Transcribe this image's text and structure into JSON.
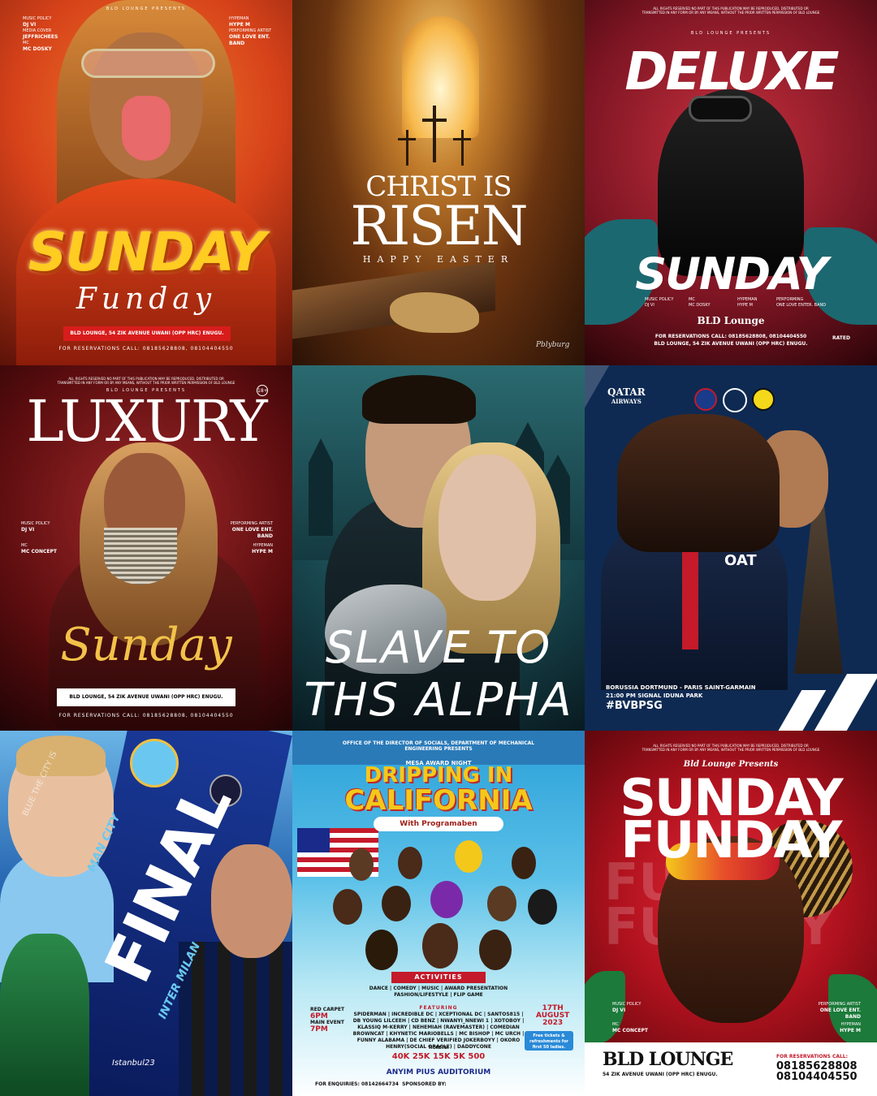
{
  "tiles": {
    "t1": {
      "presenter": "BLD LOUNGE PRESENTS",
      "left_roles": [
        "MUSIC POLICY",
        "DJ VI",
        "MEDIA COVER",
        "JEFFRICHEES",
        "MC",
        "MC DOSKY"
      ],
      "right_roles": [
        "HYPEMAN",
        "HYPE M",
        "PERFORMING ARTIST",
        "ONE LOVE ENT.",
        "BAND"
      ],
      "title": "SUNDAY",
      "script": "Funday",
      "address": "BLD LOUNGE, 54 ZIK AVENUE UWANI (OPP HRC) ENUGU.",
      "reservations": "FOR RESERVATIONS CALL: 08185628808, 08104404550"
    },
    "t2": {
      "line1": "CHRIST IS",
      "line2": "RISEN",
      "line3": "HAPPY EASTER",
      "signature": "Pblyburg"
    },
    "t3": {
      "notice": "ALL RIGHTS RESERVED NO PART OF THIS PUBLICATION MAY BE REPRODUCED, DISTRIBUTED OR TRANSMITTED IN ANY FORM OR BY ANY MEANS, WITHOUT THE PRIOR WRITTEN PERMISSION OF BLD LOUNGE",
      "presenter": "BLD LOUNGE PRESENTS",
      "title": "DELUXE",
      "title2": "SUNDAY",
      "roles": [
        "MUSIC POLICY",
        "DJ VI",
        "MC",
        "MC DOSKY",
        "HYPEMAN",
        "HYPE M",
        "PERFORMING",
        "ONE LOVE ENTER. BAND"
      ],
      "brand": "BLD Lounge",
      "reservations": "FOR RESERVATIONS CALL: 08185628808, 08104404550",
      "address": "BLD LOUNGE, 54 ZIK AVENUE UWANI (OPP HRC) ENUGU.",
      "rated": "RATED"
    },
    "t4": {
      "notice": "ALL RIGHTS RESERVED NO PART OF THIS PUBLICATION MAY BE REPRODUCED, DISTRIBUTED OR TRANSMITTED IN ANY FORM OR BY ANY MEANS, WITHOUT THE PRIOR WRITTEN PERMISSION OF BLD LOUNGE",
      "presenter": "BLD LOUNGE PRESENTS",
      "badge": "18+",
      "title": "LUXURY",
      "left_roles": [
        "MUSIC POLICY",
        "DJ VI",
        "MC",
        "MC CONCEPT"
      ],
      "right_roles": [
        "PERFORMING ARTIST",
        "ONE LOVE ENT.",
        "BAND",
        "HYPEMAN",
        "HYPE M"
      ],
      "script": "Sunday",
      "address": "BLD LOUNGE, 54 ZIK AVENUE UWANI (OPP HRC) ENUGU.",
      "reservations": "FOR RESERVATIONS CALL: 08185628808, 08104404550"
    },
    "t5": {
      "line1": "SLAVE TO",
      "line2": "THS ALPHA"
    },
    "t6": {
      "sponsor": "QATAR",
      "sponsor_sub": "AIRWAYS",
      "kit_text": "OAT",
      "match": "BORUSSIA DORTMUND - PARIS SAINT-GARMAIN",
      "time": "21:00 PM  SIGNAL IDUNA PARK",
      "hashtag": "#BVBPSG"
    },
    "t7": {
      "title": "FINAL",
      "team1": "MAN CITY",
      "team2": "INTER MILAN",
      "side": "BLUE THE CITY IS",
      "venue": "Istanbul23"
    },
    "t8": {
      "office": "OFFICE OF THE DIRECTOR OF SOCIALS, DEPARTMENT OF MECHANICAL ENGINEERING PRESENTS",
      "event": "MESA AWARD NIGHT",
      "title1": "DRIPPING IN",
      "title2": "CALIFORNIA",
      "with": "With Programaben",
      "activities": "ACTIVITIES",
      "activity_list": "DANCE | COMEDY | MUSIC | AWARD PRESENTATION FASHION/LIFESTYLE | FLIP GAME",
      "featuring": "FEATURING",
      "lineup": "SPIDERMAN | INCREDIBLE DC | XCEPTIONAL DC | SANTOS815 | DB YOUNG LILCEEH | CD BENZ | NWANYI_NNEWI 1 | XOTOBOY | KLASSIQ M-KERRY | NEHEMIAH (RAVEMASTER) | COMEDIAN BROWNCAT | KHYNETIC MARIOBELLS | MC BISHOP | MC URCH | FUNNY ALABAMA | DE CHIEF VERIFIED JOKERBOYY | OKORO HENRY(SOCIAL ORACLE) | DADDYCONE",
      "times": [
        "RED CARPET",
        "6PM",
        "MAIN EVENT",
        "7PM"
      ],
      "date": [
        "17TH",
        "AUGUST",
        "2023"
      ],
      "free": "Free tickets & refreshments for first 50 ladies.",
      "tickets": "TICKETS:",
      "ticket_prices": "40K   25K   15K   5K   500",
      "venue": "ANYIM PIUS AUDITORIUM",
      "enquiries": "FOR ENQUIRIES: 08142664734",
      "sponsored": "SPONSORED BY:"
    },
    "t9": {
      "notice": "ALL RIGHTS RESERVED NO PART OF THIS PUBLICATION MAY BE REPRODUCED, DISTRIBUTED OR TRANSMITTED IN ANY FORM OR BY ANY MEANS, WITHOUT THE PRIOR WRITTEN PERMISSION OF BLD LOUNGE",
      "presenter": "Bld Lounge Presents",
      "title1": "SUNDAY",
      "title2": "FUNDAY",
      "left_roles": [
        "MUSIC POLICY",
        "DJ VI",
        "MC",
        "MC CONCEPT"
      ],
      "right_roles": [
        "PERFORMING ARTIST",
        "ONE LOVE ENT.",
        "BAND",
        "HYPEMAN",
        "HYPE M"
      ],
      "brand": "BLD LOUNGE",
      "address": "54 ZIK AVENUE UWANI (OPP HRC) ENUGU.",
      "reservations_label": "FOR RESERVATIONS CALL:",
      "phone1": "08185628808",
      "phone2": "08104404550"
    }
  }
}
